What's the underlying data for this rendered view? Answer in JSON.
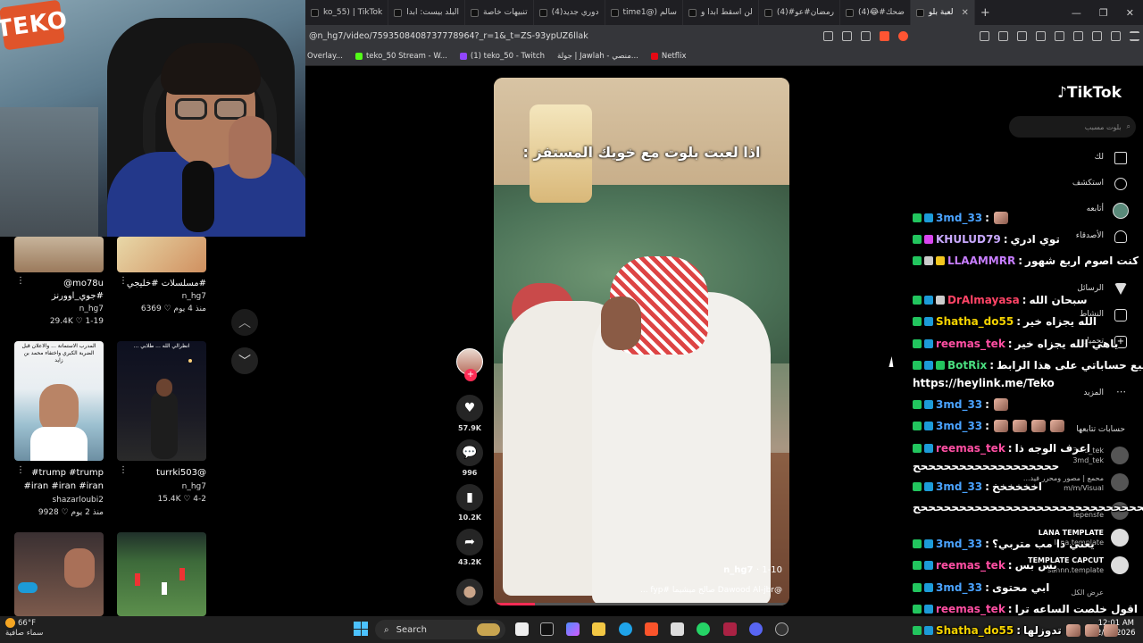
{
  "browser": {
    "tabs": [
      {
        "label": "ko_55) | TikTok"
      },
      {
        "label": "البلد بيست: ابدا"
      },
      {
        "label": "تنبيهات خاصة"
      },
      {
        "label": "(4)دوري جديد"
      },
      {
        "label": "time1@) سالم"
      },
      {
        "label": "لن اسقط ابدا و"
      },
      {
        "label": "(4)#رمضان#عو"
      },
      {
        "label": "(4)😂#ضحك"
      },
      {
        "label": "لعبة بلو",
        "active": true
      }
    ],
    "url": "@n_hg7/video/7593508408737778964?_r=1&_t=ZS-93ypUZ6llak",
    "bookmarks": [
      {
        "label": "Overlay...",
        "color": "#888888"
      },
      {
        "label": "teko_50 Stream - W...",
        "color": "#53fc18"
      },
      {
        "label": "(1) teko_50 - Twitch",
        "color": "#9146ff"
      },
      {
        "label": "جولة | Jawlah - منصي...",
        "color": "#dddddd"
      },
      {
        "label": "Netflix",
        "color": "#e50914"
      }
    ]
  },
  "webcam": {
    "logo": "TEKO"
  },
  "grid": {
    "items": [
      {
        "caption": "mo78u@",
        "sub1": "#جوي_اوورنز",
        "sub2": "n_hg7",
        "stats": "29.4K ♡  1-19"
      },
      {
        "caption": "#مسلسلات #خليجي",
        "sub1": "n_hg7",
        "sub2": "",
        "stats": "6369 ♡  منذ 4 يوم"
      },
      {
        "caption": "trump #trump#",
        "sub1": "#iran #iran #iran",
        "sub2": "shazarloubi2",
        "stats": "9928 ♡  منذ 2 يوم"
      },
      {
        "caption": "turrki503@",
        "sub1": "n_hg7",
        "sub2": "",
        "stats": "15.4K ♡  4-2"
      }
    ],
    "thumb_text_1": "المدرب الاستماتة ... والاعلان قبل الضربة الكبري واختفاء محمد بن زايد",
    "thumb_text_2": "انظرالي الله ... طلابي ..."
  },
  "video": {
    "overlay_title": "اذا لعبت بلوت مع خويك المستفز :",
    "author": "n_hg7",
    "date": "1-10",
    "caption": "@Dawood Al-jbr صالح ميشيما #fyp ...",
    "progress": 0.14
  },
  "rail": {
    "likes": "57.9K",
    "comments": "996",
    "saves": "10.2K",
    "shares": "43.2K"
  },
  "tiktok": {
    "logo": "TikTok",
    "search_placeholder": "بلوت مسبب",
    "nav": [
      "لك",
      "استكشف",
      "أتابعه",
      "الأصدقاء",
      "الرسائل",
      "النشاط",
      "تحميل",
      "المزيد"
    ],
    "following_title": "حسابات تتابعها",
    "following": [
      {
        "name": "3md_tek",
        "handle": "3md_tek"
      },
      {
        "name": "محمع | مصور ومحرر فيد...",
        "handle": "m/m/Visual"
      },
      {
        "name": "lepensfe",
        "handle": ""
      },
      {
        "name": "LANA TEMPLATE",
        "handle": "lana.template"
      },
      {
        "name": "TEMPLATE CAPCUT",
        "handle": "sannn.template"
      }
    ],
    "show_all": "عرض الكل"
  },
  "chat": [
    {
      "user": "3md_33",
      "color": "#4aa3ff",
      "badges": [
        "bg",
        "bb"
      ],
      "message": "",
      "emotes": 1
    },
    {
      "user": "KHULUD79",
      "color": "#c9a9ff",
      "badges": [
        "bg",
        "bp"
      ],
      "message": "توي ادري",
      "emotes": 0
    },
    {
      "user": "LLAAMMRR",
      "color": "#c77dff",
      "badges": [
        "bg",
        "bw",
        "by"
      ],
      "message": "كنت اصوم اربع شهور",
      "emotes": 0
    },
    {
      "user": "DrAlmayasa",
      "color": "#ff4466",
      "badges": [
        "bg",
        "bb",
        "bw"
      ],
      "message": "سبحان الله",
      "emotes": 0
    },
    {
      "user": "Shatha_do55",
      "color": "#f5d300",
      "badges": [
        "bg",
        "bb"
      ],
      "message": "الله يجزاه خير",
      "emotes": 0
    },
    {
      "user": "reemas_tek",
      "color": "#ff4fa3",
      "badges": [
        "bg",
        "bb"
      ],
      "message": "ياهي الله يجزاه خير",
      "emotes": 0
    },
    {
      "user": "BotRix",
      "color": "#4ade80",
      "badges": [
        "bg",
        "bb",
        "bg"
      ],
      "message": "جميع حساباتي على هذا الرابط",
      "emotes": 0
    },
    {
      "user": "https://heylink.me/Teko",
      "color": "#ffffff",
      "badges": [],
      "message": "",
      "emotes": 0
    },
    {
      "user": "3md_33",
      "color": "#4aa3ff",
      "badges": [
        "bg",
        "bb"
      ],
      "message": "",
      "emotes": 1
    },
    {
      "user": "3md_33",
      "color": "#4aa3ff",
      "badges": [
        "bg",
        "bb"
      ],
      "message": "",
      "emotes": 4
    },
    {
      "user": "reemas_tek",
      "color": "#ff4fa3",
      "badges": [
        "bg",
        "bb"
      ],
      "message": "اعرف الوجه ذا",
      "emotes": 0
    },
    {
      "user": "",
      "color": "#ffffff",
      "badges": [],
      "message": "ححححححححححححححححححح",
      "emotes": 0
    },
    {
      "user": "3md_33",
      "color": "#4aa3ff",
      "badges": [
        "bg",
        "bb"
      ],
      "message": "اخخخخخخ",
      "emotes": 0
    },
    {
      "user": "",
      "color": "#ffffff",
      "badges": [],
      "message": "ححححححححححححححححححححححححححححححححححح",
      "emotes": 0
    },
    {
      "user": "3md_33",
      "color": "#4aa3ff",
      "badges": [
        "bg",
        "bb"
      ],
      "message": "يعني ذا مب متربي؟",
      "emotes": 0
    },
    {
      "user": "reemas_tek",
      "color": "#ff4fa3",
      "badges": [
        "bg",
        "bb"
      ],
      "message": "بس بس",
      "emotes": 0
    },
    {
      "user": "3md_33",
      "color": "#4aa3ff",
      "badges": [
        "bg",
        "bb"
      ],
      "message": "ابي محتوى",
      "emotes": 0
    },
    {
      "user": "reemas_tek",
      "color": "#ff4fa3",
      "badges": [
        "bg",
        "bb"
      ],
      "message": "اقول خلصت الساعه ترا",
      "emotes": 0
    },
    {
      "user": "Shatha_do55",
      "color": "#f5d300",
      "badges": [
        "bg",
        "bb"
      ],
      "message": "تدوزلها",
      "emotes": 3
    }
  ],
  "taskbar": {
    "weather_temp": "66°F",
    "weather_desc": "سماء صافية",
    "search": "Search",
    "time": "12:01 AM",
    "date": "2/19/2026"
  }
}
